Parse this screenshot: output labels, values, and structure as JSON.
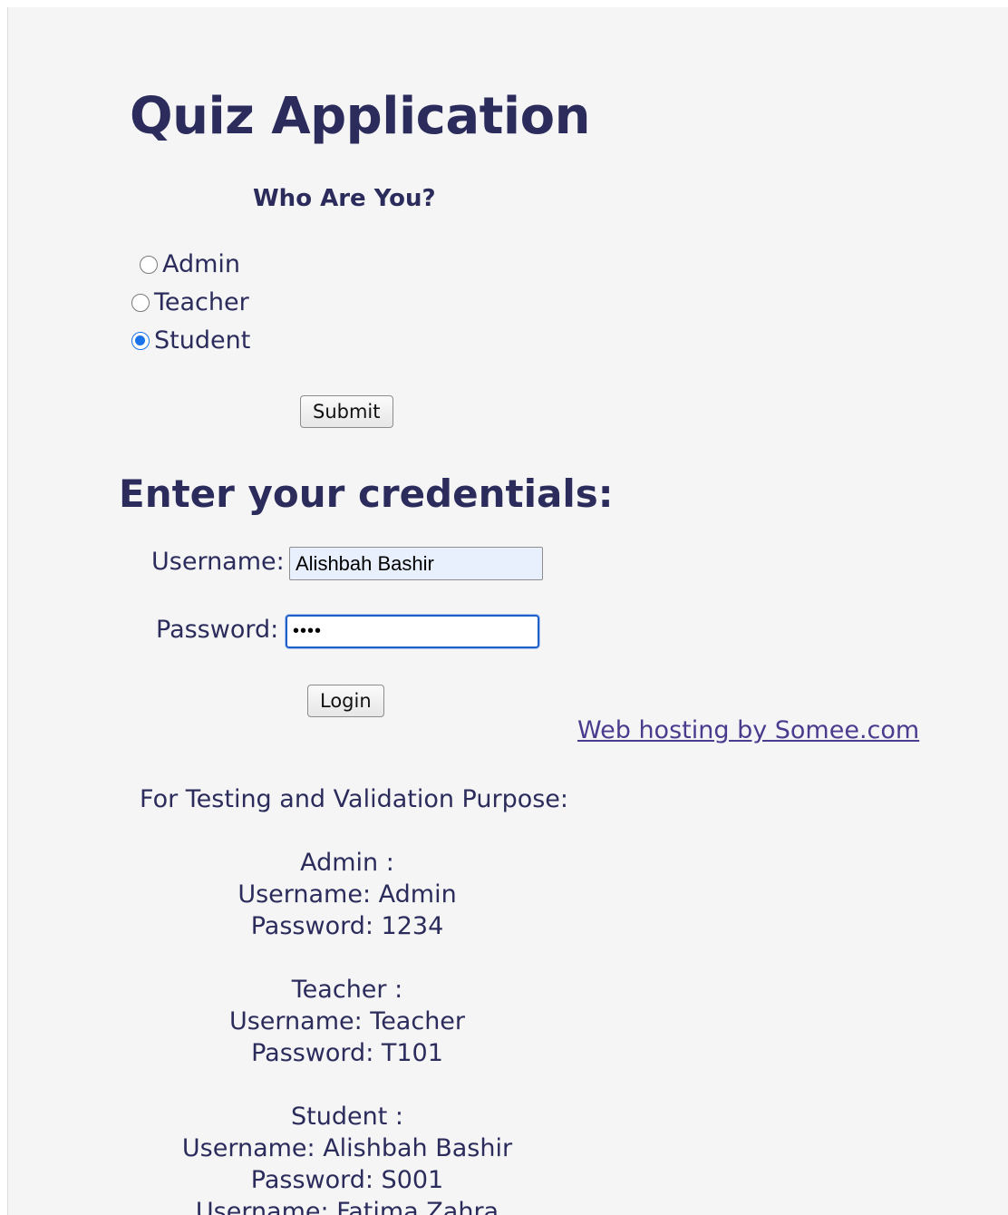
{
  "app": {
    "title": "Quiz Application"
  },
  "role_section": {
    "heading": "Who Are You?",
    "options": [
      {
        "label": "Admin",
        "checked": false
      },
      {
        "label": "Teacher",
        "checked": false
      },
      {
        "label": "Student",
        "checked": true
      }
    ],
    "submit_label": "Submit"
  },
  "login_section": {
    "heading": "Enter your credentials:",
    "username_label": "Username:",
    "username_value": "Alishbah Bashir",
    "password_label": "Password:",
    "password_value": "••••",
    "login_label": "Login"
  },
  "footer_link": "Web hosting by Somee.com",
  "testing": {
    "heading": "For Testing and Validation Purpose:",
    "admin": {
      "role": "Admin :",
      "username": "Username: Admin",
      "password": "Password: 1234"
    },
    "teacher": {
      "role": "Teacher :",
      "username": "Username: Teacher",
      "password": "Password: T101"
    },
    "student": {
      "role": "Student :",
      "username": "Username: Alishbah Bashir",
      "password": "Password: S001",
      "extra_username": "Username: Fatima Zahra"
    }
  },
  "colors": {
    "text": "#2b2c5c",
    "radio_checked": "#1a73e8",
    "link": "#4b3b8f",
    "background": "#f5f5f5"
  }
}
